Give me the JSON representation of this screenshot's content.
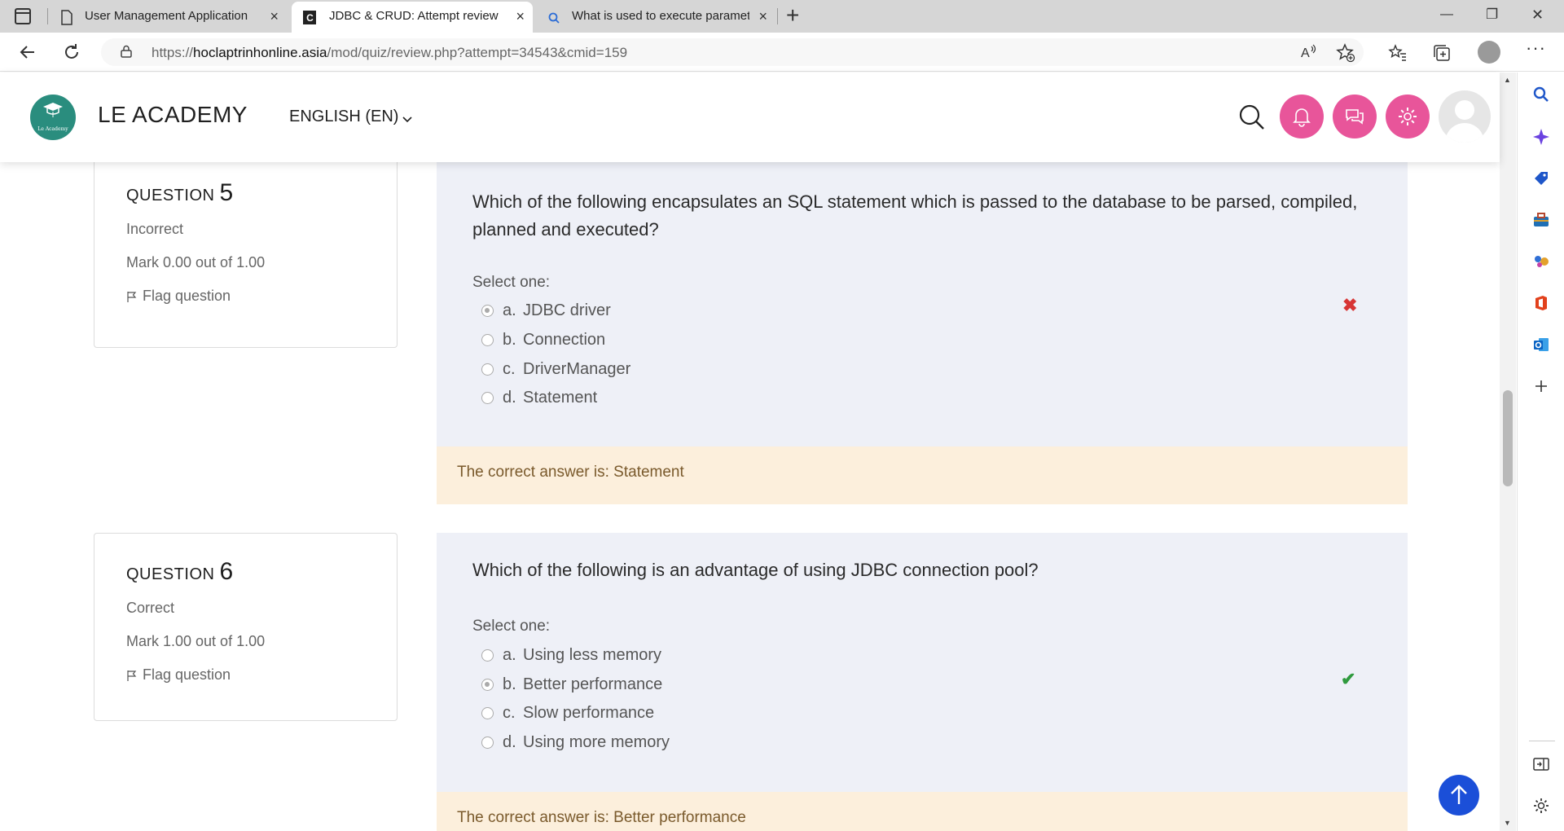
{
  "browser": {
    "tabs": [
      {
        "title": "User Management Application",
        "close": "×"
      },
      {
        "title": "JDBC & CRUD: Attempt review",
        "close": "×"
      },
      {
        "title": "What is used to execute paramet",
        "close": "×"
      }
    ],
    "new_tab": "+",
    "window_controls": {
      "minimize": "—",
      "restore": "❐",
      "close": "✕"
    },
    "url_prefix": "https://",
    "url_host": "hoclaptrinhonline.asia",
    "url_path": "/mod/quiz/review.php?attempt=34543&cmid=159",
    "sidebar_icons": [
      "search-icon",
      "copilot-icon",
      "shopping-tag-icon",
      "toolbox-icon",
      "games-icon",
      "office-icon",
      "outlook-icon",
      "add-icon",
      "sidebar-toggle-icon",
      "settings-icon"
    ]
  },
  "site": {
    "brand": "LE ACADEMY",
    "logo_text": "Le Academy",
    "language": "ENGLISH (EN)",
    "accent_color": "#e8559a"
  },
  "questions": [
    {
      "label": "QUESTION",
      "number": "5",
      "status": "Incorrect",
      "mark": "Mark 0.00 out of 1.00",
      "flag": "Flag question",
      "text": "Which of the following encapsulates an SQL statement which is passed to the database to be parsed, compiled, planned and executed?",
      "select_one": "Select one:",
      "options": [
        {
          "letter": "a.",
          "text": "JDBC driver",
          "selected": true
        },
        {
          "letter": "b.",
          "text": "Connection",
          "selected": false
        },
        {
          "letter": "c.",
          "text": "DriverManager",
          "selected": false
        },
        {
          "letter": "d.",
          "text": "Statement",
          "selected": false
        }
      ],
      "result_mark": "✖",
      "correct_answer": "The correct answer is: Statement"
    },
    {
      "label": "QUESTION",
      "number": "6",
      "status": "Correct",
      "mark": "Mark 1.00 out of 1.00",
      "flag": "Flag question",
      "text": "Which of the following is an advantage of using JDBC connection pool?",
      "select_one": "Select one:",
      "options": [
        {
          "letter": "a.",
          "text": "Using less memory",
          "selected": false
        },
        {
          "letter": "b.",
          "text": "Better performance",
          "selected": true
        },
        {
          "letter": "c.",
          "text": "Slow performance",
          "selected": false
        },
        {
          "letter": "d.",
          "text": "Using more memory",
          "selected": false
        }
      ],
      "result_mark": "✔",
      "correct_answer": "The correct answer is: Better performance"
    }
  ]
}
